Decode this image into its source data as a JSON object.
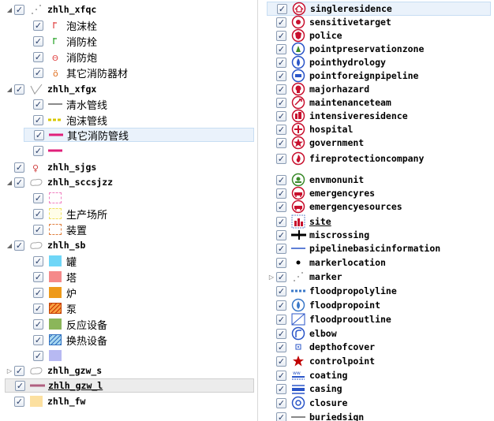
{
  "left_tree": {
    "groups": [
      {
        "label": "zhlh_xfqc",
        "expanded": true,
        "children": [
          {
            "label": "泡沫栓"
          },
          {
            "label": "消防栓"
          },
          {
            "label": "消防炮"
          },
          {
            "label": "其它消防器材"
          }
        ]
      },
      {
        "label": "zhlh_xfgx",
        "expanded": true,
        "children": [
          {
            "label": "清水管线"
          },
          {
            "label": "泡沫管线"
          },
          {
            "label": "其它消防管线"
          },
          {
            "label": ""
          }
        ]
      },
      {
        "label": "zhlh_sjgs",
        "expanded": false,
        "children": []
      },
      {
        "label": "zhlh_sccsjzz",
        "expanded": true,
        "children": [
          {
            "label": ""
          },
          {
            "label": "生产场所"
          },
          {
            "label": "装置"
          }
        ]
      },
      {
        "label": "zhlh_sb",
        "expanded": true,
        "children": [
          {
            "label": "罐"
          },
          {
            "label": "塔"
          },
          {
            "label": "炉"
          },
          {
            "label": "泵"
          },
          {
            "label": "反应设备"
          },
          {
            "label": "换热设备"
          },
          {
            "label": ""
          }
        ]
      },
      {
        "label": "zhlh_gzw_s",
        "expanded": false,
        "children": []
      },
      {
        "label": "zhlh_gzw_l",
        "expanded": false,
        "children": []
      },
      {
        "label": "zhlh_fw",
        "expanded": false,
        "children": []
      }
    ]
  },
  "right_tree": {
    "items": [
      {
        "label": "singleresidence",
        "icon": "home-icon"
      },
      {
        "label": "sensitivetarget",
        "icon": "crosshair-icon"
      },
      {
        "label": "police",
        "icon": "police-badge-icon"
      },
      {
        "label": "pointpreservationzone",
        "icon": "preservation-zone-icon"
      },
      {
        "label": "pointhydrology",
        "icon": "water-drop-icon"
      },
      {
        "label": "pointforeignpipeline",
        "icon": "pipeline-icon"
      },
      {
        "label": "majorhazard",
        "icon": "hazard-skull-icon"
      },
      {
        "label": "maintenanceteam",
        "icon": "maintenance-team-icon"
      },
      {
        "label": "intensiveresidence",
        "icon": "buildings-icon"
      },
      {
        "label": "hospital",
        "icon": "hospital-cross-icon"
      },
      {
        "label": "government",
        "icon": "government-star-icon"
      },
      {
        "label": "fireprotectioncompany",
        "icon": "fire-company-icon"
      },
      {
        "label": "envmonunit",
        "icon": "env-monitor-icon"
      },
      {
        "label": "emergencyres",
        "icon": "emergency-vehicle-icon"
      },
      {
        "label": "emergencyesources",
        "icon": "emergency-vehicle-icon"
      },
      {
        "label": "site",
        "icon": "site-icon"
      },
      {
        "label": "miscrossing",
        "icon": "crossing-icon"
      },
      {
        "label": "pipelinebasicinformation",
        "icon": "blue-line-icon"
      },
      {
        "label": "markerlocation",
        "icon": "dot-icon"
      },
      {
        "label": "marker",
        "icon": "marker-dots-icon"
      },
      {
        "label": "floodpropolyline",
        "icon": "dashed-line-icon"
      },
      {
        "label": "floodpropoint",
        "icon": "flood-point-icon"
      },
      {
        "label": "floodprooutline",
        "icon": "hatched-box-icon"
      },
      {
        "label": "elbow",
        "icon": "elbow-icon"
      },
      {
        "label": "depthofcover",
        "icon": "depth-icon"
      },
      {
        "label": "controlpoint",
        "icon": "red-star-icon"
      },
      {
        "label": "coating",
        "icon": "coating-icon"
      },
      {
        "label": "casing",
        "icon": "casing-icon"
      },
      {
        "label": "closure",
        "icon": "closure-icon"
      },
      {
        "label": "buriedsign",
        "icon": "gray-line-icon"
      }
    ]
  },
  "colors": {
    "accent_selected": "#eaf2fb",
    "magenta": "#e0207a",
    "cyan_swatch": "#6fd6f7",
    "pink_swatch": "#f58a8a",
    "orange_swatch": "#ee9a1a",
    "green_swatch": "#8bb65a",
    "lavender_swatch": "#b7b9f2",
    "peach_swatch": "#fce0a0"
  }
}
